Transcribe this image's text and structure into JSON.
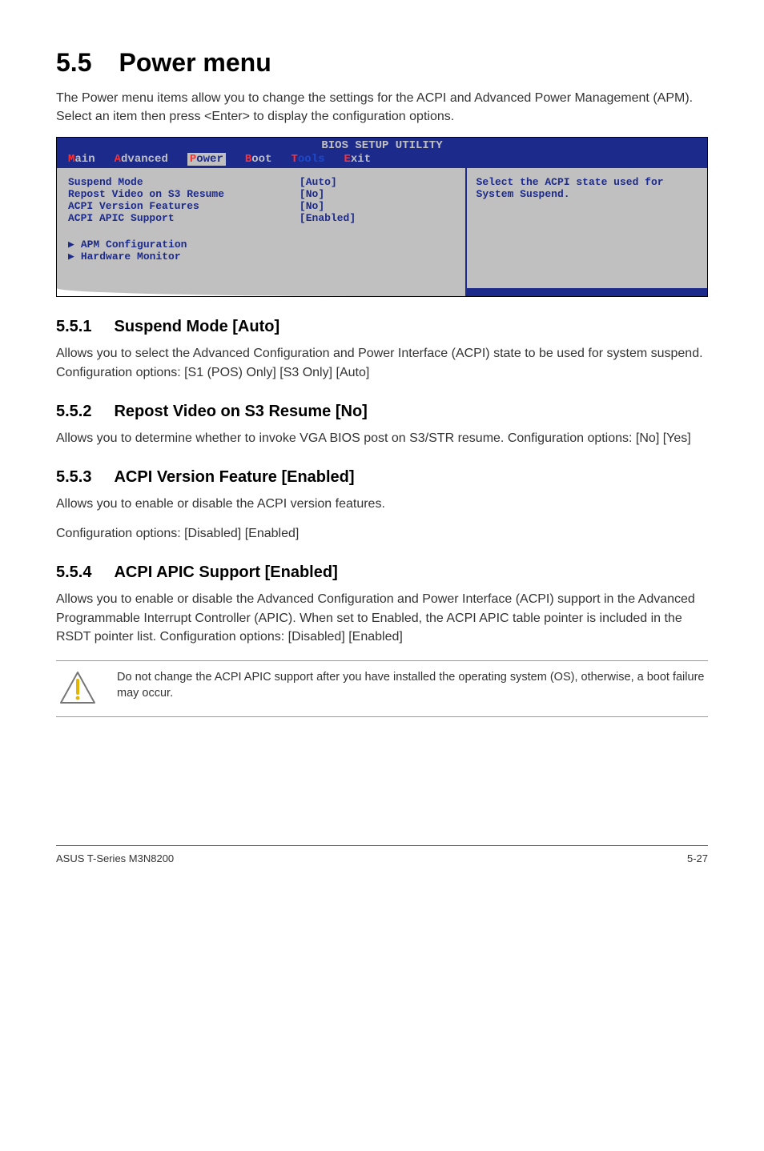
{
  "section": {
    "number": "5.5",
    "title": "Power menu",
    "intro": "The Power menu items allow you to change the settings for the ACPI and Advanced Power Management (APM). Select an item then press <Enter> to display the configuration options."
  },
  "bios": {
    "header": "BIOS SETUP UTILITY",
    "tabs": {
      "main": "Main",
      "advanced": "Advanced",
      "power": "Power",
      "boot": "Boot",
      "tools": "Tools",
      "exit": "Exit"
    },
    "rows": [
      {
        "label": "Suspend Mode",
        "value": "[Auto]"
      },
      {
        "label": "Repost Video on S3 Resume",
        "value": "[No]"
      },
      {
        "label": "ACPI Version Features",
        "value": "[No]"
      },
      {
        "label": "ACPI APIC Support",
        "value": "[Enabled]"
      }
    ],
    "submenus": [
      "APM Configuration",
      "Hardware Monitor"
    ],
    "help": "Select the ACPI state used for System Suspend."
  },
  "subsections": [
    {
      "number": "5.5.1",
      "title": "Suspend Mode [Auto]",
      "paragraphs": [
        "Allows you to select the Advanced Configuration and Power Interface (ACPI) state to be used for system suspend.  Configuration options: [S1 (POS) Only] [S3 Only] [Auto]"
      ]
    },
    {
      "number": "5.5.2",
      "title": "Repost Video on S3 Resume [No]",
      "paragraphs": [
        "Allows you to determine whether to invoke VGA BIOS post on S3/STR resume. Configuration options: [No] [Yes]"
      ]
    },
    {
      "number": "5.5.3",
      "title": "ACPI Version Feature [Enabled]",
      "paragraphs": [
        "Allows you to enable or disable the ACPI version features.",
        "Configuration options: [Disabled] [Enabled]"
      ]
    },
    {
      "number": "5.5.4",
      "title": "ACPI APIC Support [Enabled]",
      "paragraphs": [
        "Allows you to enable or disable the Advanced Configuration and Power Interface (ACPI) support in the Advanced Programmable Interrupt Controller (APIC). When set to Enabled, the ACPI APIC table pointer is included in the RSDT pointer list. Configuration options: [Disabled] [Enabled]"
      ]
    }
  ],
  "note": {
    "text": "Do not change the ACPI APIC support after you have installed the operating system (OS), otherwise, a boot failure may occur."
  },
  "footer": {
    "left": "ASUS T-Series M3N8200",
    "right": "5-27"
  },
  "icons": {
    "triangle": "▶",
    "warning": "warning-icon"
  }
}
